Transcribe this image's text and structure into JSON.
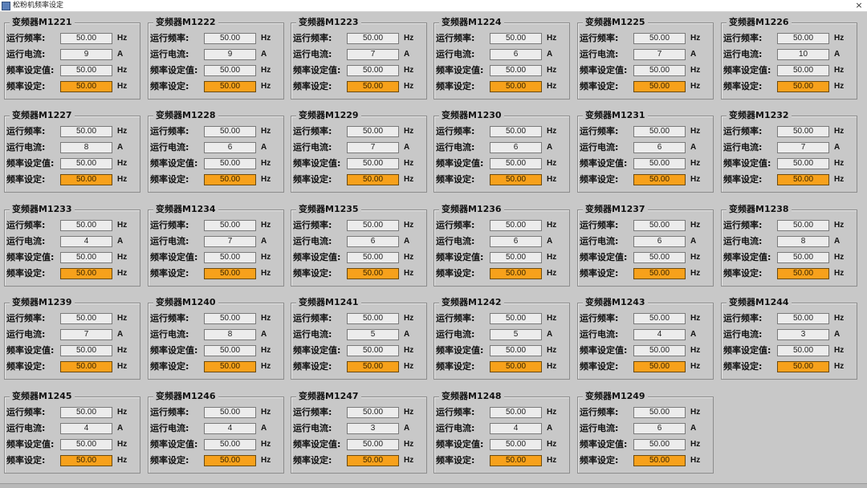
{
  "window": {
    "title": "松粉机频率设定",
    "close_label": "×"
  },
  "labels": {
    "run_freq": "运行频率:",
    "run_current": "运行电流:",
    "freq_setval": "频率设定值:",
    "freq_set": "频率设定:"
  },
  "units": {
    "hz": "Hz",
    "a": "A"
  },
  "colors": {
    "setpoint_bg": "#f7a11b",
    "readonly_bg": "#ececec",
    "background": "#c8c8c8"
  },
  "panels": [
    {
      "title": "变频器M1221",
      "run_freq": "50.00",
      "run_current": "9",
      "freq_setval": "50.00",
      "freq_set": "50.00"
    },
    {
      "title": "变频器M1222",
      "run_freq": "50.00",
      "run_current": "9",
      "freq_setval": "50.00",
      "freq_set": "50.00"
    },
    {
      "title": "变频器M1223",
      "run_freq": "50.00",
      "run_current": "7",
      "freq_setval": "50.00",
      "freq_set": "50.00"
    },
    {
      "title": "变频器M1224",
      "run_freq": "50.00",
      "run_current": "6",
      "freq_setval": "50.00",
      "freq_set": "50.00"
    },
    {
      "title": "变频器M1225",
      "run_freq": "50.00",
      "run_current": "7",
      "freq_setval": "50.00",
      "freq_set": "50.00"
    },
    {
      "title": "变频器M1226",
      "run_freq": "50.00",
      "run_current": "10",
      "freq_setval": "50.00",
      "freq_set": "50.00"
    },
    {
      "title": "变频器M1227",
      "run_freq": "50.00",
      "run_current": "8",
      "freq_setval": "50.00",
      "freq_set": "50.00"
    },
    {
      "title": "变频器M1228",
      "run_freq": "50.00",
      "run_current": "6",
      "freq_setval": "50.00",
      "freq_set": "50.00"
    },
    {
      "title": "变频器M1229",
      "run_freq": "50.00",
      "run_current": "7",
      "freq_setval": "50.00",
      "freq_set": "50.00"
    },
    {
      "title": "变频器M1230",
      "run_freq": "50.00",
      "run_current": "6",
      "freq_setval": "50.00",
      "freq_set": "50.00"
    },
    {
      "title": "变频器M1231",
      "run_freq": "50.00",
      "run_current": "6",
      "freq_setval": "50.00",
      "freq_set": "50.00"
    },
    {
      "title": "变频器M1232",
      "run_freq": "50.00",
      "run_current": "7",
      "freq_setval": "50.00",
      "freq_set": "50.00"
    },
    {
      "title": "变频器M1233",
      "run_freq": "50.00",
      "run_current": "4",
      "freq_setval": "50.00",
      "freq_set": "50.00"
    },
    {
      "title": "变频器M1234",
      "run_freq": "50.00",
      "run_current": "7",
      "freq_setval": "50.00",
      "freq_set": "50.00"
    },
    {
      "title": "变频器M1235",
      "run_freq": "50.00",
      "run_current": "6",
      "freq_setval": "50.00",
      "freq_set": "50.00"
    },
    {
      "title": "变频器M1236",
      "run_freq": "50.00",
      "run_current": "6",
      "freq_setval": "50.00",
      "freq_set": "50.00"
    },
    {
      "title": "变频器M1237",
      "run_freq": "50.00",
      "run_current": "6",
      "freq_setval": "50.00",
      "freq_set": "50.00"
    },
    {
      "title": "变频器M1238",
      "run_freq": "50.00",
      "run_current": "8",
      "freq_setval": "50.00",
      "freq_set": "50.00"
    },
    {
      "title": "变频器M1239",
      "run_freq": "50.00",
      "run_current": "7",
      "freq_setval": "50.00",
      "freq_set": "50.00"
    },
    {
      "title": "变频器M1240",
      "run_freq": "50.00",
      "run_current": "8",
      "freq_setval": "50.00",
      "freq_set": "50.00"
    },
    {
      "title": "变频器M1241",
      "run_freq": "50.00",
      "run_current": "5",
      "freq_setval": "50.00",
      "freq_set": "50.00"
    },
    {
      "title": "变频器M1242",
      "run_freq": "50.00",
      "run_current": "5",
      "freq_setval": "50.00",
      "freq_set": "50.00"
    },
    {
      "title": "变频器M1243",
      "run_freq": "50.00",
      "run_current": "4",
      "freq_setval": "50.00",
      "freq_set": "50.00"
    },
    {
      "title": "变频器M1244",
      "run_freq": "50.00",
      "run_current": "3",
      "freq_setval": "50.00",
      "freq_set": "50.00"
    },
    {
      "title": "变频器M1245",
      "run_freq": "50.00",
      "run_current": "4",
      "freq_setval": "50.00",
      "freq_set": "50.00"
    },
    {
      "title": "变频器M1246",
      "run_freq": "50.00",
      "run_current": "4",
      "freq_setval": "50.00",
      "freq_set": "50.00"
    },
    {
      "title": "变频器M1247",
      "run_freq": "50.00",
      "run_current": "3",
      "freq_setval": "50.00",
      "freq_set": "50.00"
    },
    {
      "title": "变频器M1248",
      "run_freq": "50.00",
      "run_current": "4",
      "freq_setval": "50.00",
      "freq_set": "50.00"
    },
    {
      "title": "变频器M1249",
      "run_freq": "50.00",
      "run_current": "6",
      "freq_setval": "50.00",
      "freq_set": "50.00"
    }
  ]
}
